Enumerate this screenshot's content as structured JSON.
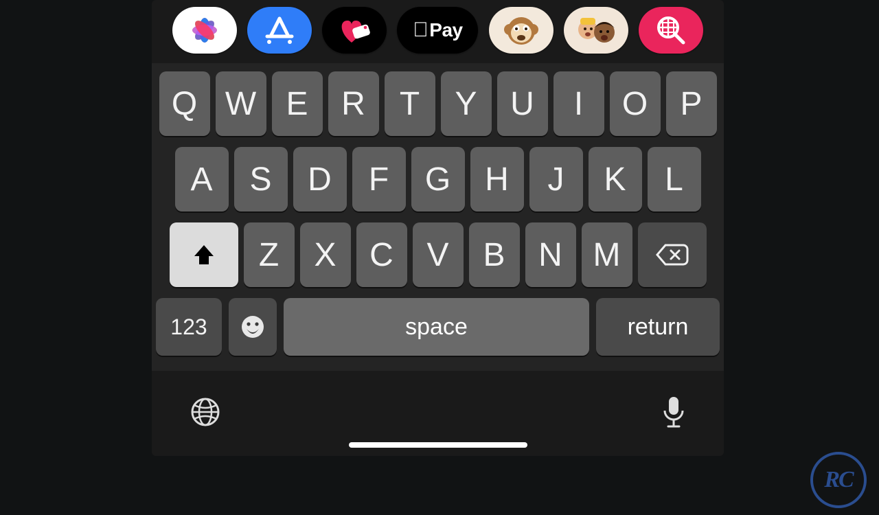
{
  "app_strip": {
    "items": [
      {
        "name": "photos-app"
      },
      {
        "name": "app-store"
      },
      {
        "name": "fitness-plus"
      },
      {
        "name": "apple-pay",
        "label": "Pay"
      },
      {
        "name": "memoji-monkey"
      },
      {
        "name": "memoji-people"
      },
      {
        "name": "hashtag-images"
      }
    ]
  },
  "keyboard": {
    "row1": [
      "Q",
      "W",
      "E",
      "R",
      "T",
      "Y",
      "U",
      "I",
      "O",
      "P"
    ],
    "row2": [
      "A",
      "S",
      "D",
      "F",
      "G",
      "H",
      "J",
      "K",
      "L"
    ],
    "row3": [
      "Z",
      "X",
      "C",
      "V",
      "B",
      "N",
      "M"
    ],
    "num_label": "123",
    "space_label": "space",
    "return_label": "return"
  },
  "watermark": {
    "text": "RC"
  }
}
